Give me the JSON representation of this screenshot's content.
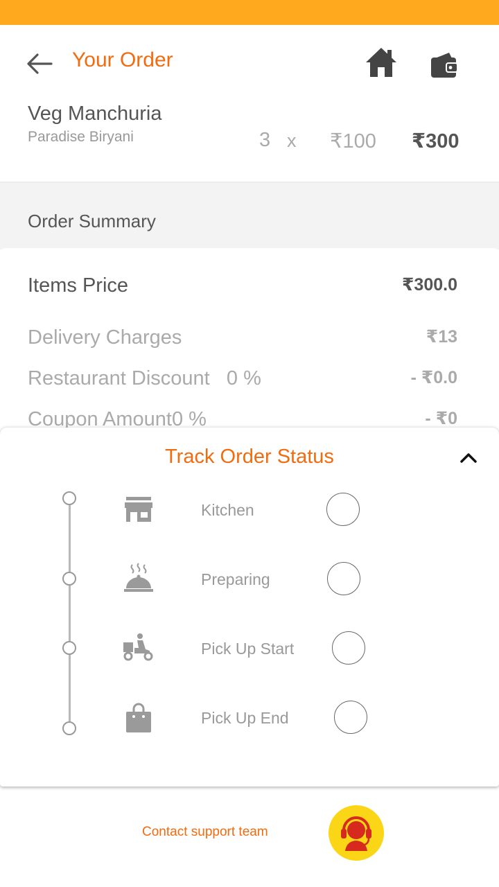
{
  "header": {
    "title": "Your Order",
    "back_icon": "arrow-left-icon",
    "home_icon": "home-icon",
    "wallet_icon": "wallet-icon"
  },
  "item": {
    "name": "Veg Manchuria",
    "restaurant": "Paradise Biryani",
    "quantity": "3",
    "times": "x",
    "unit_price": "₹100",
    "total": "₹300"
  },
  "summary": {
    "title": "Order Summary",
    "items_price_label": "Items Price",
    "items_price_value": "₹300.0",
    "delivery_label": "Delivery Charges",
    "delivery_value": "₹13",
    "restaurant_discount_label": "Restaurant Discount   0 %",
    "restaurant_discount_value": "- ₹0.0",
    "coupon_label": "Coupon Amount0 %",
    "coupon_value": "- ₹0"
  },
  "track": {
    "title": "Track Order Status",
    "steps": [
      {
        "label": "Kitchen",
        "icon": "store-icon",
        "done": false
      },
      {
        "label": "Preparing",
        "icon": "cloche-icon",
        "done": false
      },
      {
        "label": "Pick Up Start",
        "icon": "delivery-scooter-icon",
        "done": false
      },
      {
        "label": "Pick Up End",
        "icon": "shopping-bag-icon",
        "done": false
      }
    ]
  },
  "support": {
    "label": "Contact support team",
    "icon": "headset-support-icon"
  },
  "colors": {
    "status_bar": "#FFA91F",
    "accent": "#F26B0F",
    "support_button": "#FBD617",
    "support_icon": "#D62A1E"
  }
}
